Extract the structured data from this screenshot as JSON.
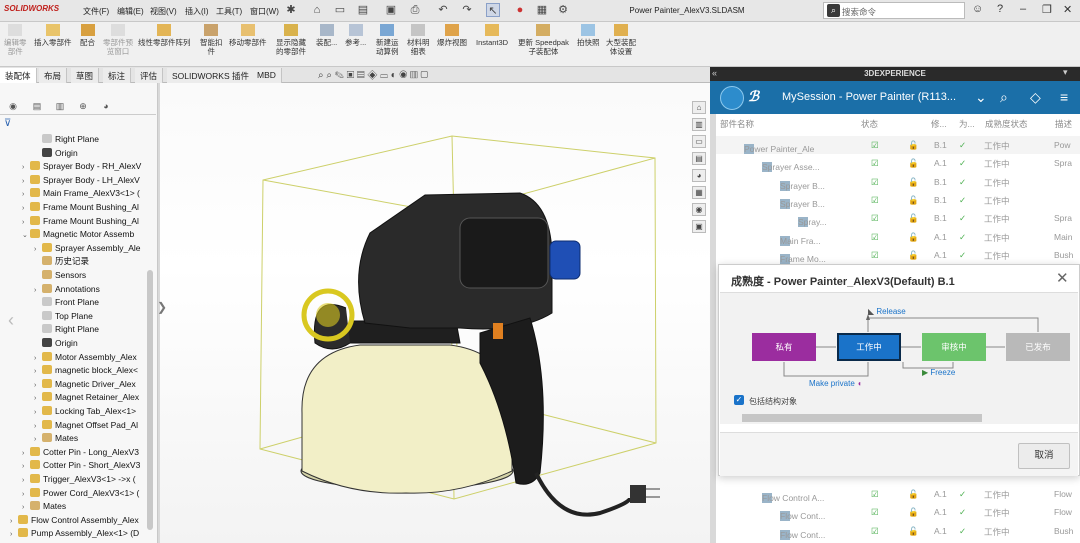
{
  "app": {
    "logo": "SOLIDWORKS",
    "window_title": "Power Painter_AlexV3.SLDASM",
    "search_placeholder": "搜索命令"
  },
  "menu": [
    "文件(F)",
    "编辑(E)",
    "视图(V)",
    "插入(I)",
    "工具(T)",
    "窗口(W)"
  ],
  "ribbon": [
    {
      "label": "编辑零\n部件",
      "disabled": true
    },
    {
      "label": "插入零部件",
      "disabled": false
    },
    {
      "label": "配合",
      "disabled": false
    },
    {
      "label": "零部件预\n览窗口",
      "disabled": true
    },
    {
      "label": "线性零部件阵列",
      "disabled": false
    },
    {
      "label": "智能扣\n件",
      "disabled": false
    },
    {
      "label": "移动零部件",
      "disabled": false
    },
    {
      "label": "显示隐藏\n的零部件",
      "disabled": false
    },
    {
      "label": "装配...",
      "disabled": false
    },
    {
      "label": "参考...",
      "disabled": false
    },
    {
      "label": "新建运\n动算例",
      "disabled": false
    },
    {
      "label": "材料明\n细表",
      "disabled": false
    },
    {
      "label": "爆炸视图",
      "disabled": false
    },
    {
      "label": "Instant3D",
      "disabled": false
    },
    {
      "label": "更新 Speedpak\n子装配体",
      "disabled": false
    },
    {
      "label": "拍快照",
      "disabled": false
    },
    {
      "label": "大型装配\n体设置",
      "disabled": false
    }
  ],
  "tabs": [
    "装配体",
    "布局",
    "草图",
    "标注",
    "评估",
    "SOLIDWORKS 插件",
    "MBD"
  ],
  "tree": [
    {
      "label": "Right Plane",
      "indent": 2,
      "arrow": ""
    },
    {
      "label": "Origin",
      "indent": 2,
      "arrow": ""
    },
    {
      "label": "Sprayer Body - RH_AlexV",
      "indent": 1,
      "arrow": "›"
    },
    {
      "label": "Sprayer Body - LH_AlexV",
      "indent": 1,
      "arrow": "›"
    },
    {
      "label": "Main Frame_AlexV3<1> (",
      "indent": 1,
      "arrow": "›"
    },
    {
      "label": "Frame Mount Bushing_Al",
      "indent": 1,
      "arrow": "›"
    },
    {
      "label": "Frame Mount Bushing_Al",
      "indent": 1,
      "arrow": "›"
    },
    {
      "label": "Magnetic Motor Assemb",
      "indent": 1,
      "arrow": "⌄"
    },
    {
      "label": "Sprayer Assembly_Ale",
      "indent": 2,
      "arrow": "›"
    },
    {
      "label": "历史记录",
      "indent": 2,
      "arrow": ""
    },
    {
      "label": "Sensors",
      "indent": 2,
      "arrow": ""
    },
    {
      "label": "Annotations",
      "indent": 2,
      "arrow": "›"
    },
    {
      "label": "Front Plane",
      "indent": 2,
      "arrow": ""
    },
    {
      "label": "Top Plane",
      "indent": 2,
      "arrow": ""
    },
    {
      "label": "Right Plane",
      "indent": 2,
      "arrow": ""
    },
    {
      "label": "Origin",
      "indent": 2,
      "arrow": ""
    },
    {
      "label": "Motor Assembly_Alex",
      "indent": 2,
      "arrow": "›"
    },
    {
      "label": "magnetic block_Alex<",
      "indent": 2,
      "arrow": "›"
    },
    {
      "label": "Magnetic Driver_Alex",
      "indent": 2,
      "arrow": "›"
    },
    {
      "label": "Magnet Retainer_Alex",
      "indent": 2,
      "arrow": "›"
    },
    {
      "label": "Locking Tab_Alex<1>",
      "indent": 2,
      "arrow": "›"
    },
    {
      "label": "Magnet Offset Pad_Al",
      "indent": 2,
      "arrow": "›"
    },
    {
      "label": "Mates",
      "indent": 2,
      "arrow": "›"
    },
    {
      "label": "Cotter Pin - Long_AlexV3",
      "indent": 1,
      "arrow": "›"
    },
    {
      "label": "Cotter Pin - Short_AlexV3",
      "indent": 1,
      "arrow": "›"
    },
    {
      "label": "Trigger_AlexV3<1> ->x (",
      "indent": 1,
      "arrow": "›"
    },
    {
      "label": "Power Cord_AlexV3<1> (",
      "indent": 1,
      "arrow": "›"
    },
    {
      "label": "Mates",
      "indent": 1,
      "arrow": "›"
    },
    {
      "label": "Flow Control Assembly_Alex",
      "indent": 0,
      "arrow": "›"
    },
    {
      "label": "Pump Assembly_Alex<1> (D",
      "indent": 0,
      "arrow": "›"
    }
  ],
  "x3d": {
    "header": "3DEXPERIENCE",
    "session": "MySession - Power Painter (R113...",
    "columns": [
      "部件名称",
      "状态",
      "修...",
      "为...",
      "成熟度状态",
      "描述"
    ],
    "rows_top": [
      {
        "name": "Power Painter_Ale",
        "rev": "B.1",
        "maturity": "工作中",
        "desc": "Pow",
        "indent": 0
      },
      {
        "name": "Sprayer Asse...",
        "rev": "A.1",
        "maturity": "工作中",
        "desc": "Spra",
        "indent": 1
      },
      {
        "name": "Sprayer B...",
        "rev": "B.1",
        "maturity": "工作中",
        "desc": "",
        "indent": 2
      },
      {
        "name": "Sprayer B...",
        "rev": "B.1",
        "maturity": "工作中",
        "desc": "",
        "indent": 2
      },
      {
        "name": "Spray...",
        "rev": "B.1",
        "maturity": "工作中",
        "desc": "Spra",
        "indent": 3
      },
      {
        "name": "Main Fra...",
        "rev": "A.1",
        "maturity": "工作中",
        "desc": "Main",
        "indent": 2
      },
      {
        "name": "Frame Mo...",
        "rev": "A.1",
        "maturity": "工作中",
        "desc": "Bush",
        "indent": 2
      }
    ],
    "rows_bottom": [
      {
        "name": "Flow Control A...",
        "rev": "A.1",
        "maturity": "工作中",
        "desc": "Flow",
        "indent": 1
      },
      {
        "name": "Flow Cont...",
        "rev": "A.1",
        "maturity": "工作中",
        "desc": "Flow",
        "indent": 2
      },
      {
        "name": "Flow Cont...",
        "rev": "A.1",
        "maturity": "工作中",
        "desc": "Bush",
        "indent": 2
      }
    ]
  },
  "dialog": {
    "title": "成熟度 - Power Painter_AlexV3(Default) B.1",
    "states": [
      {
        "label": "私有",
        "color": "#9b2d9f"
      },
      {
        "label": "工作中",
        "color": "#1a73c9"
      },
      {
        "label": "审核中",
        "color": "#6cc46c"
      },
      {
        "label": "已发布",
        "color": "#b9b9b9"
      }
    ],
    "transitions": {
      "release": "Release",
      "make_private": "Make private",
      "freeze": "Freeze"
    },
    "checkbox_label": "包括结构对象",
    "cancel": "取消"
  }
}
